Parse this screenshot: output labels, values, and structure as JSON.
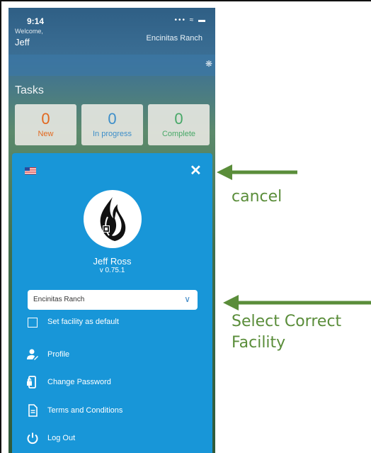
{
  "status_bar": {
    "time": "9:14",
    "icons": "••• ≈ ▬"
  },
  "header": {
    "welcome": "Welcome,",
    "user": "Jeff",
    "facility": "Encinitas Ranch"
  },
  "tasks": {
    "title": "Tasks",
    "cards": [
      {
        "count": "0",
        "label": "New",
        "color": "#e2681f"
      },
      {
        "count": "0",
        "label": "In progress",
        "color": "#3d8ec9"
      },
      {
        "count": "0",
        "label": "Complete",
        "color": "#48a868"
      }
    ]
  },
  "menu": {
    "flag_icon": "us-flag-icon",
    "close_icon": "close-icon",
    "avatar_icon": "flame-logo-icon",
    "name": "Jeff Ross",
    "version": "v 0.75.1",
    "facility_select": {
      "value": "Encinitas Ranch",
      "chevron_icon": "chevron-down-icon"
    },
    "default_checkbox": {
      "label": "Set facility as default",
      "checked": false
    },
    "items": [
      {
        "label": "Profile",
        "icon": "profile-icon"
      },
      {
        "label": "Change Password",
        "icon": "phone-lock-icon"
      },
      {
        "label": "Terms and Conditions",
        "icon": "document-icon"
      },
      {
        "label": "Log Out",
        "icon": "power-icon"
      }
    ],
    "accent_color": "#1896d8"
  },
  "annotations": {
    "cancel": "cancel",
    "select_line1": "Select Correct",
    "select_line2": "Facility",
    "color": "#5a8d3a"
  }
}
